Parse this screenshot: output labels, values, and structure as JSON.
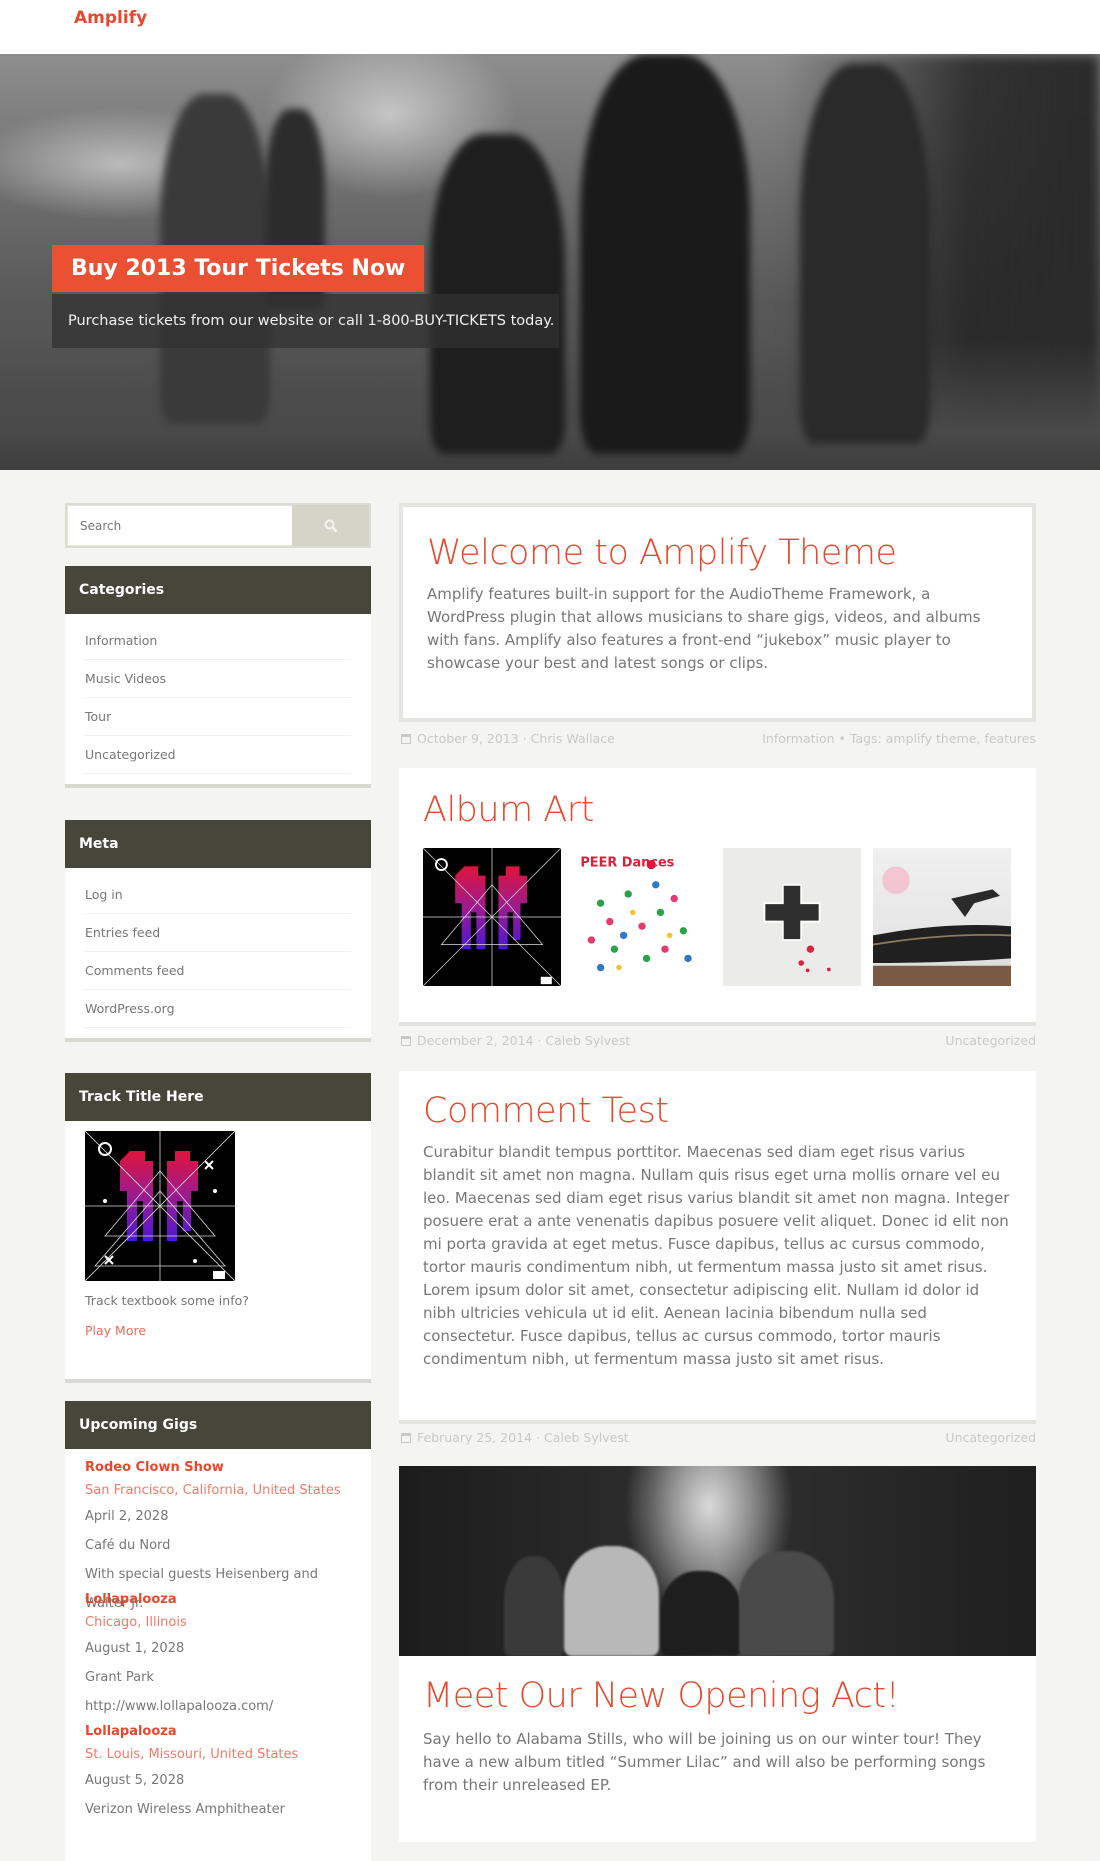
{
  "header": {
    "site_title": "Amplify"
  },
  "hero": {
    "title": "Buy 2013 Tour Tickets Now",
    "subtitle": "Purchase tickets from our website or call 1-800-BUY-TICKETS today."
  },
  "colors": {
    "accent": "#e6492d",
    "widget_header": "#47463b",
    "background": "#f4f4f2"
  },
  "sidebar": {
    "search": {
      "placeholder": "Search",
      "value": "",
      "button_icon": "search-icon"
    },
    "categories": {
      "title": "Categories",
      "items": [
        {
          "label": "Information"
        },
        {
          "label": "Music Videos"
        },
        {
          "label": "Tour"
        },
        {
          "label": "Uncategorized"
        }
      ]
    },
    "meta": {
      "title": "Meta",
      "items": [
        {
          "label": "Log in"
        },
        {
          "label": "Entries feed"
        },
        {
          "label": "Comments feed"
        },
        {
          "label": "WordPress.org"
        }
      ]
    },
    "track": {
      "title": "Track Title Here",
      "text": "Track textbook some info?",
      "link": "Play More"
    },
    "gigs": {
      "title": "Upcoming Gigs",
      "items": [
        {
          "name": "Rodeo Clown Show",
          "location": "San Francisco, California, United States",
          "date": "April 2, 2028",
          "venue": "Café du Nord",
          "note": "With special guests Heisenberg and Walter Jr."
        },
        {
          "name": "Lollapalooza",
          "location": "Chicago, Illinois",
          "date": "August 1, 2028",
          "venue": "Grant Park",
          "note": "http://www.lollapalooza.com/"
        },
        {
          "name": "Lollapalooza",
          "location": "St. Louis, Missouri, United States",
          "date": "August 5, 2028",
          "venue": "Verizon Wireless Amphitheater"
        }
      ]
    }
  },
  "posts": [
    {
      "title": "Welcome to Amplify Theme",
      "body": "Amplify features built-in support for the AudioTheme Framework, a WordPress plugin that allows musicians to share gigs, videos, and albums with fans. Amplify also features a front-end “jukebox” music player to showcase your best and latest songs or clips.",
      "meta_left": "October 9, 2013 · Chris Wallace",
      "meta_right": "Information • Tags: amplify theme, features"
    },
    {
      "title": "Album Art",
      "albums": [
        "album-cover-pixel-heart",
        "album-cover-peer-dances",
        "album-cover-gamepad",
        "album-cover-turntable"
      ],
      "album_text": "PEER Dances",
      "meta_left": "December 2, 2014 · Caleb Sylvest",
      "meta_right": "Uncategorized"
    },
    {
      "title": "Comment Test",
      "body": "Curabitur blandit tempus porttitor. Maecenas sed diam eget risus varius blandit sit amet non magna. Nullam quis risus eget urna mollis ornare vel eu leo. Maecenas sed diam eget risus varius blandit sit amet non magna. Integer posuere erat a ante venenatis dapibus posuere velit aliquet. Donec id elit non mi porta gravida at eget metus. Fusce dapibus, tellus ac cursus commodo, tortor mauris condimentum nibh, ut fermentum massa justo sit amet risus. Lorem ipsum dolor sit amet, consectetur adipiscing elit. Nullam id dolor id nibh ultricies vehicula ut id elit. Aenean lacinia bibendum nulla sed consectetur. Fusce dapibus, tellus ac cursus commodo, tortor mauris condimentum nibh, ut fermentum massa justo sit amet risus.",
      "meta_left": "February 25, 2014 · Caleb Sylvest",
      "meta_right": "Uncategorized"
    },
    {
      "title": "Meet Our New Opening Act!",
      "body": "Say hello to Alabama Stills, who will be joining us on our winter tour! They have a new album titled “Summer Lilac” and will also be performing songs from their unreleased EP."
    }
  ]
}
